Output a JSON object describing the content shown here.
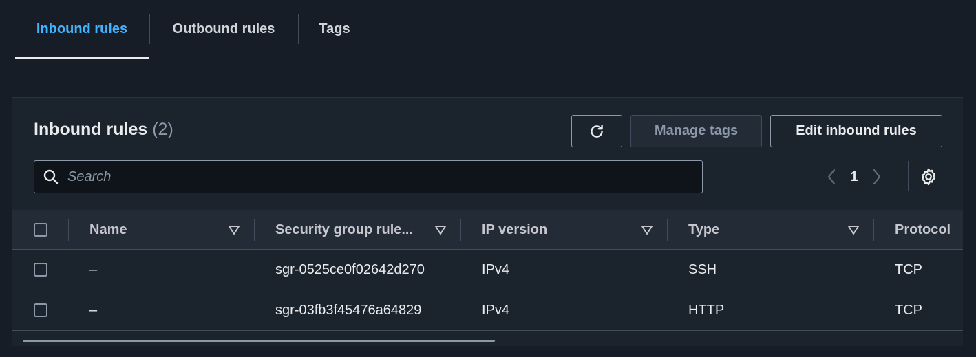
{
  "tabs": [
    {
      "label": "Inbound rules",
      "active": true
    },
    {
      "label": "Outbound rules",
      "active": false
    },
    {
      "label": "Tags",
      "active": false
    }
  ],
  "panel": {
    "title": "Inbound rules",
    "count": "(2)",
    "refresh_icon": "refresh-icon",
    "manage_tags_label": "Manage tags",
    "edit_rules_label": "Edit inbound rules",
    "search_placeholder": "Search",
    "page_number": "1"
  },
  "table": {
    "columns": [
      "Name",
      "Security group rule...",
      "IP version",
      "Type",
      "Protocol"
    ],
    "rows": [
      {
        "name": "–",
        "rule_id": "sgr-0525ce0f02642d270",
        "ip_version": "IPv4",
        "type": "SSH",
        "protocol": "TCP"
      },
      {
        "name": "–",
        "rule_id": "sgr-03fb3f45476a64829",
        "ip_version": "IPv4",
        "type": "HTTP",
        "protocol": "TCP"
      }
    ]
  },
  "colors": {
    "background": "#161d26",
    "active_tab": "#42b4ff",
    "text": "#e9ebed",
    "muted": "#8d99a8"
  }
}
